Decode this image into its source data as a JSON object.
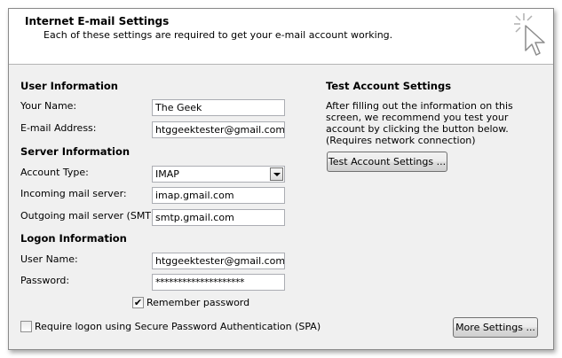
{
  "header": {
    "title": "Internet E-mail Settings",
    "subtitle": "Each of these settings are required to get your e-mail account working.",
    "graphic_icon": "cursor-sparkle-icon"
  },
  "user_info": {
    "heading": "User Information",
    "name_label": "Your Name:",
    "name_value": "The Geek",
    "email_label": "E-mail Address:",
    "email_value": "htggeektester@gmail.com"
  },
  "server_info": {
    "heading": "Server Information",
    "account_type_label": "Account Type:",
    "account_type_value": "IMAP",
    "incoming_label": "Incoming mail server:",
    "incoming_value": "imap.gmail.com",
    "outgoing_label": "Outgoing mail server (SMTP):",
    "outgoing_value": "smtp.gmail.com"
  },
  "logon_info": {
    "heading": "Logon Information",
    "username_label": "User Name:",
    "username_value": "htggeektester@gmail.com",
    "password_label": "Password:",
    "password_value": "********************",
    "remember_label": "Remember password",
    "remember_checked": true,
    "spa_label": "Require logon using Secure Password Authentication (SPA)",
    "spa_checked": false
  },
  "test_settings": {
    "heading": "Test Account Settings",
    "description": "After filling out the information on this screen, we recommend you test your account by clicking the button below. (Requires network connection)",
    "button_label": "Test Account Settings ..."
  },
  "more_settings_label": "More Settings ...",
  "colors": {
    "panel_bg": "#f0f0f0",
    "header_bg": "#ffffff",
    "field_border": "#abadb3"
  }
}
